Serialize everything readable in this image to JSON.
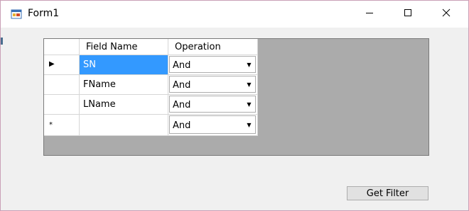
{
  "window": {
    "title": "Form1",
    "icons": {
      "app": "form-app-icon",
      "minimize": "minimize-icon",
      "maximize": "maximize-icon",
      "close": "close-icon"
    }
  },
  "grid": {
    "columns": [
      "Field Name",
      "Operation"
    ],
    "rows": [
      {
        "indicator": "▶",
        "field": "SN",
        "operation": "And",
        "selected": true
      },
      {
        "indicator": "",
        "field": "FName",
        "operation": "And",
        "selected": false
      },
      {
        "indicator": "",
        "field": "LName",
        "operation": "And",
        "selected": false
      },
      {
        "indicator": "*",
        "field": "",
        "operation": "And",
        "selected": false
      }
    ],
    "dropdown_glyph": "▼"
  },
  "buttons": {
    "get_filter": "Get Filter"
  },
  "colors": {
    "selection": "#3399ff",
    "grid_background": "#ababab",
    "form_background": "#f0f0f0"
  }
}
